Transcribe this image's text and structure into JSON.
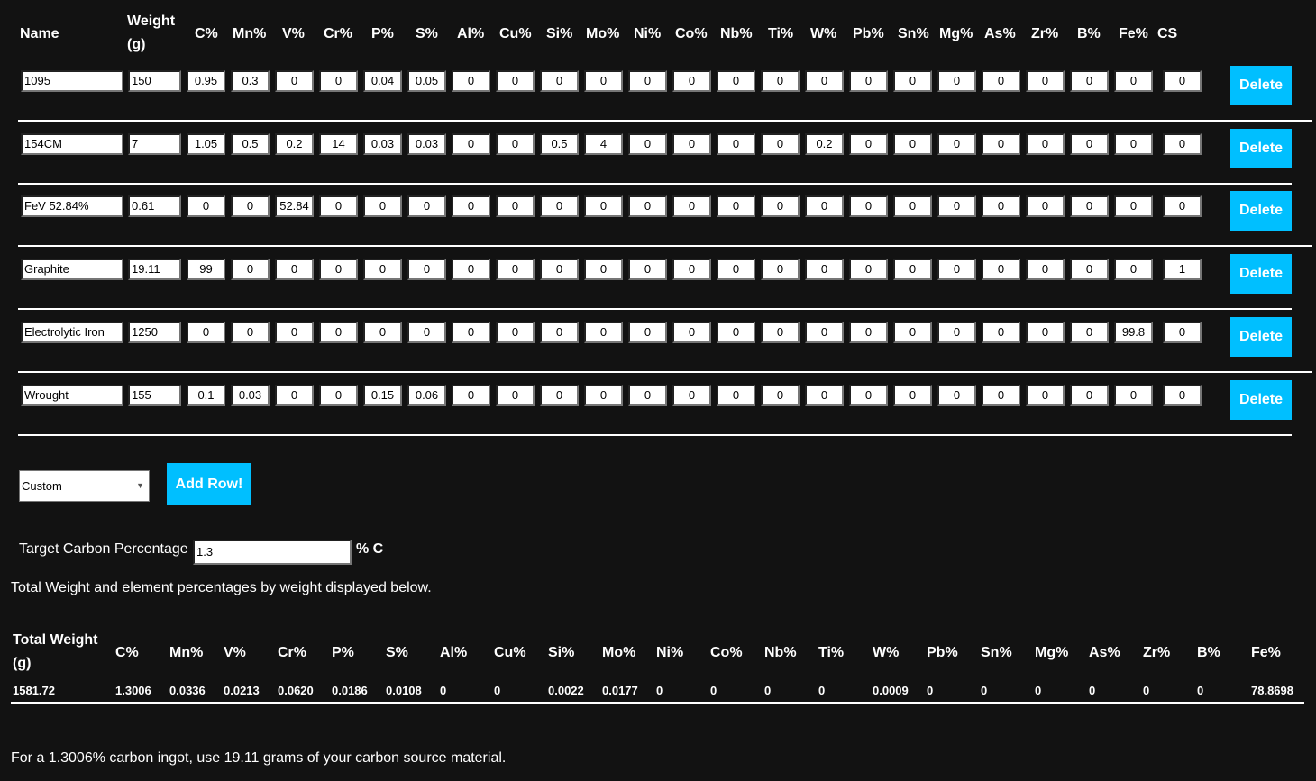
{
  "columns": [
    "Name",
    "Weight (g)",
    "C%",
    "Mn%",
    "V%",
    "Cr%",
    "P%",
    "S%",
    "Al%",
    "Cu%",
    "Si%",
    "Mo%",
    "Ni%",
    "Co%",
    "Nb%",
    "Ti%",
    "W%",
    "Pb%",
    "Sn%",
    "Mg%",
    "As%",
    "Zr%",
    "B%",
    "Fe%",
    "CS"
  ],
  "rows": [
    {
      "name": "1095",
      "weight": "150",
      "values": [
        "0.95",
        "0.3",
        "0",
        "0",
        "0.04",
        "0.05",
        "0",
        "0",
        "0",
        "0",
        "0",
        "0",
        "0",
        "0",
        "0",
        "0",
        "0",
        "0",
        "0",
        "0",
        "0",
        "0"
      ],
      "cs": "0"
    },
    {
      "name": "154CM",
      "weight": "7",
      "values": [
        "1.05",
        "0.5",
        "0.2",
        "14",
        "0.03",
        "0.03",
        "0",
        "0",
        "0.5",
        "4",
        "0",
        "0",
        "0",
        "0",
        "0.2",
        "0",
        "0",
        "0",
        "0",
        "0",
        "0",
        "0"
      ],
      "cs": "0"
    },
    {
      "name": "FeV 52.84%",
      "weight": "0.61",
      "values": [
        "0",
        "0",
        "52.84",
        "0",
        "0",
        "0",
        "0",
        "0",
        "0",
        "0",
        "0",
        "0",
        "0",
        "0",
        "0",
        "0",
        "0",
        "0",
        "0",
        "0",
        "0",
        "0"
      ],
      "cs": "0"
    },
    {
      "name": "Graphite",
      "weight": "19.11",
      "values": [
        "99",
        "0",
        "0",
        "0",
        "0",
        "0",
        "0",
        "0",
        "0",
        "0",
        "0",
        "0",
        "0",
        "0",
        "0",
        "0",
        "0",
        "0",
        "0",
        "0",
        "0",
        "0"
      ],
      "cs": "1"
    },
    {
      "name": "Electrolytic Iron",
      "weight": "1250",
      "values": [
        "0",
        "0",
        "0",
        "0",
        "0",
        "0",
        "0",
        "0",
        "0",
        "0",
        "0",
        "0",
        "0",
        "0",
        "0",
        "0",
        "0",
        "0",
        "0",
        "0",
        "0",
        "99.8"
      ],
      "cs": "0"
    },
    {
      "name": "Wrought",
      "weight": "155",
      "values": [
        "0.1",
        "0.03",
        "0",
        "0",
        "0.15",
        "0.06",
        "0",
        "0",
        "0",
        "0",
        "0",
        "0",
        "0",
        "0",
        "0",
        "0",
        "0",
        "0",
        "0",
        "0",
        "0",
        "0"
      ],
      "cs": "0"
    }
  ],
  "delete_label": "Delete",
  "preset_select": {
    "value": "Custom"
  },
  "add_row_label": "Add Row!",
  "target": {
    "label": "Target Carbon Percentage",
    "value": "1.3",
    "unit": "% C"
  },
  "totals_caption": "Total Weight and element percentages by weight displayed below.",
  "totals": {
    "headers": [
      "Total Weight (g)",
      "C%",
      "Mn%",
      "V%",
      "Cr%",
      "P%",
      "S%",
      "Al%",
      "Cu%",
      "Si%",
      "Mo%",
      "Ni%",
      "Co%",
      "Nb%",
      "Ti%",
      "W%",
      "Pb%",
      "Sn%",
      "Mg%",
      "As%",
      "Zr%",
      "B%",
      "Fe%"
    ],
    "values": [
      "1581.72",
      "1.3006",
      "0.0336",
      "0.0213",
      "0.0620",
      "0.0186",
      "0.0108",
      "0",
      "0",
      "0.0022",
      "0.0177",
      "0",
      "0",
      "0",
      "0",
      "0.0009",
      "0",
      "0",
      "0",
      "0",
      "0",
      "0",
      "78.8698"
    ]
  },
  "result_text": "For a 1.3006% carbon ingot, use 19.11 grams of your carbon source material.",
  "colors": {
    "background": "#121212",
    "accent": "#00bfff"
  }
}
